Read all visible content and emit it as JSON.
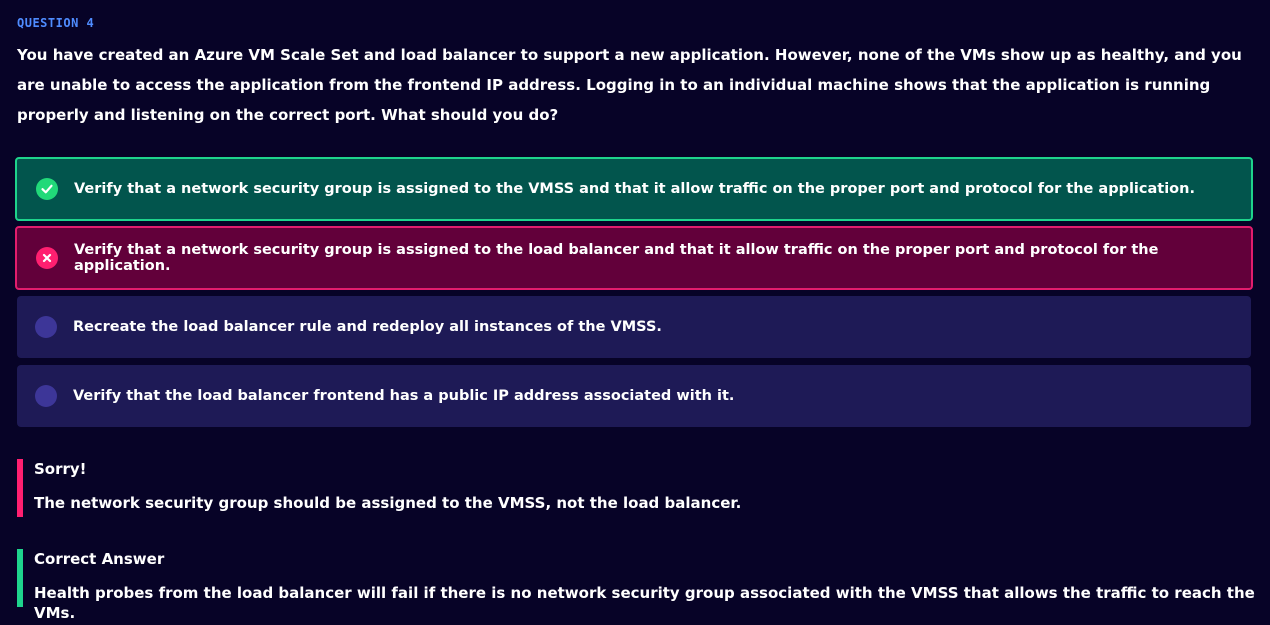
{
  "question": {
    "label": "QUESTION 4",
    "text": "You have created an Azure VM Scale Set and load balancer to support a new application. However, none of the VMs show up as healthy, and you are unable to access the application from the frontend IP address. Logging in to an individual machine shows that the application is running properly and listening on the correct port. What should you do?"
  },
  "options": [
    {
      "text": "Verify that a network security group is assigned to the VMSS and that it allow traffic on the proper port and protocol for the application.",
      "state": "correct",
      "icon": "check-icon",
      "color": "#21d979"
    },
    {
      "text": "Verify that a network security group is assigned to the load balancer and that it allow traffic on the proper port and protocol for the application.",
      "state": "incorrect-selected",
      "icon": "x-icon",
      "color": "#ff1f70"
    },
    {
      "text": "Recreate the load balancer rule and redeploy all instances of the VMSS.",
      "state": "unselected",
      "icon": "radio-icon"
    },
    {
      "text": "Verify that the load balancer frontend has a public IP address associated with it.",
      "state": "unselected",
      "icon": "radio-icon"
    }
  ],
  "feedback": {
    "sorry_title": "Sorry!",
    "sorry_text": "The network security group should be assigned to the VMSS, not the load balancer.",
    "answer_title": "Correct Answer",
    "answer_text": "Health probes from the load balancer will fail if there is no network security group associated with the VMSS that allows the traffic to reach the VMs."
  },
  "colors": {
    "background": "#070327",
    "accent_label": "#4f8cff",
    "correct": "#1ed48c",
    "incorrect": "#e21d6d"
  }
}
